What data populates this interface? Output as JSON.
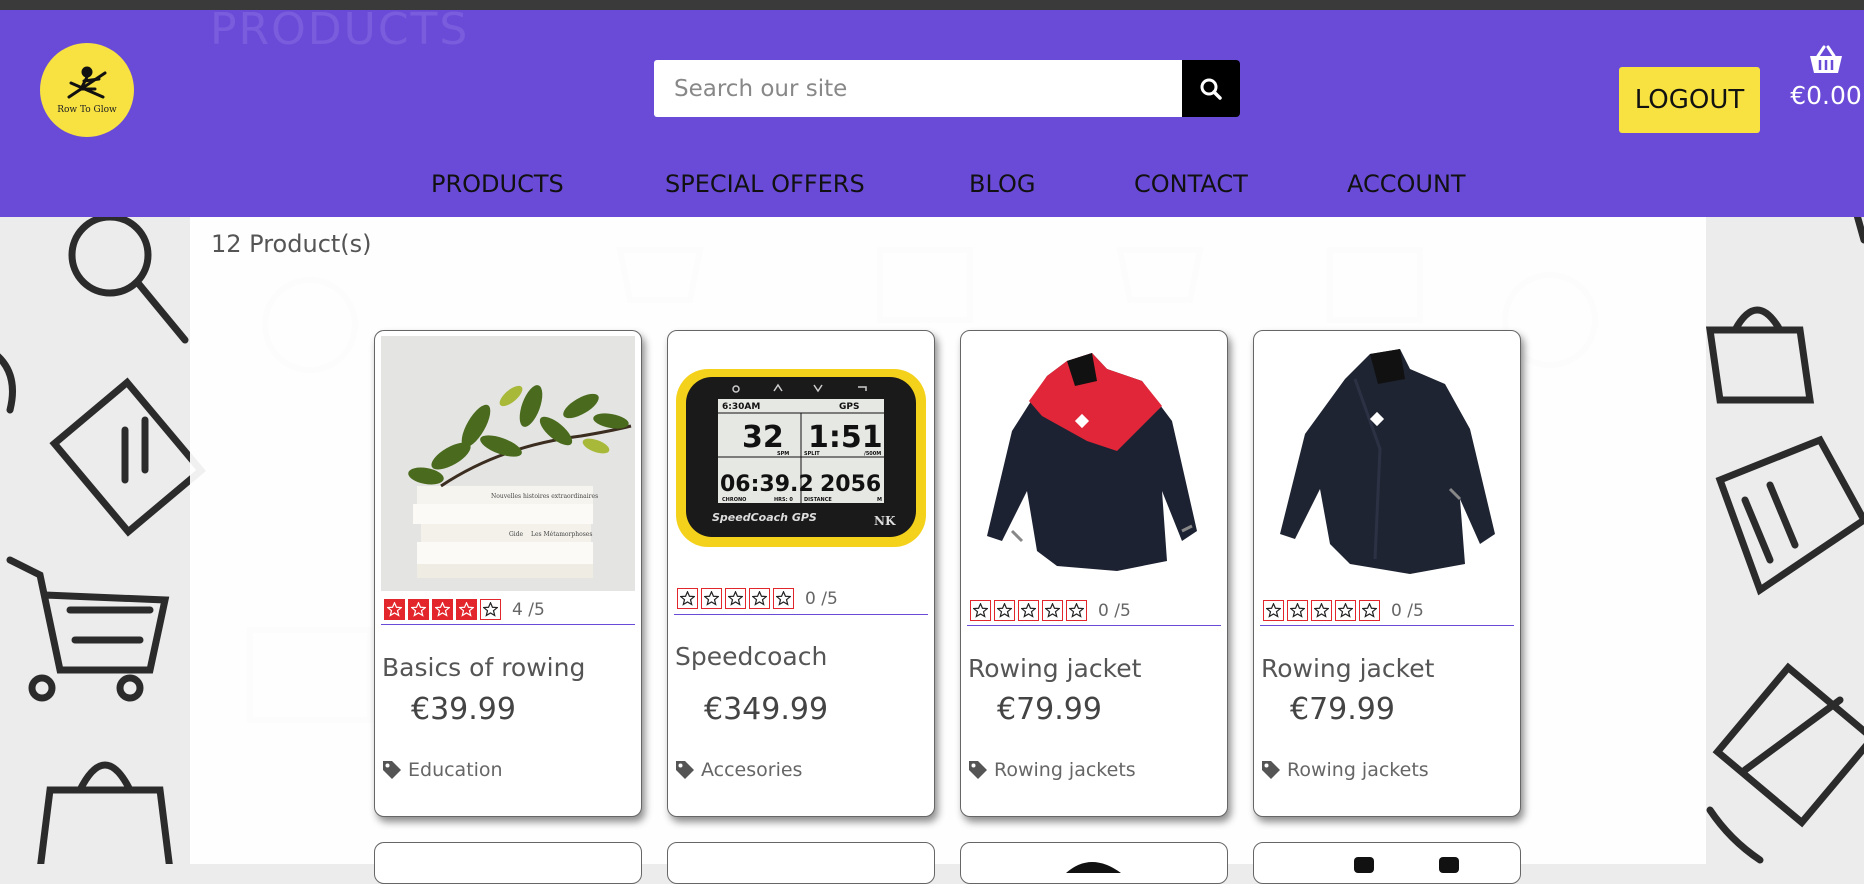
{
  "header": {
    "ghost_title": "PRODUCTS",
    "logo_text": "Row To Glow",
    "search_placeholder": "Search our site",
    "logout_label": "LOGOUT",
    "cart_total": "€0.00"
  },
  "nav": {
    "items": [
      {
        "label": "PRODUCTS"
      },
      {
        "label": "SPECIAL OFFERS"
      },
      {
        "label": "BLOG"
      },
      {
        "label": "CONTACT"
      },
      {
        "label": "ACCOUNT"
      }
    ]
  },
  "main": {
    "product_count": "12 Product(s)"
  },
  "products": [
    {
      "name": "Basics of rowing",
      "price": "€39.99",
      "rating_text": "4 /5",
      "rating": 4,
      "category": "Education",
      "image": "book-plant-icon"
    },
    {
      "name": "Speedcoach",
      "price": "€349.99",
      "rating_text": "0 /5",
      "rating": 0,
      "category": "Accesories",
      "image": "speedcoach-device-icon"
    },
    {
      "name": "Rowing jacket",
      "price": "€79.99",
      "rating_text": "0 /5",
      "rating": 0,
      "category": "Rowing jackets",
      "image": "red-jacket-icon"
    },
    {
      "name": "Rowing jacket",
      "price": "€79.99",
      "rating_text": "0 /5",
      "rating": 0,
      "category": "Rowing jackets",
      "image": "black-jacket-icon"
    }
  ],
  "speedcoach_screen": {
    "time": "6:30AM",
    "gps": "GPS",
    "stroke_rate": "32",
    "split": "1:51",
    "spm": "SPM",
    "split_label": "SPLIT",
    "per500": "/500M",
    "chrono": "06:39.2",
    "distance": "2056",
    "chrono_label": "CHRONO",
    "hrs": "HRS: 0",
    "distance_label": "DISTANCE",
    "unit": "M",
    "brand": "SpeedCoach GPS",
    "maker": "NK"
  },
  "book_titles": {
    "top": "Nouvelles histoires extraordinaires",
    "mid_left": "Gide",
    "mid_right": "Les Métamorphoses"
  },
  "colors": {
    "header_bg": "#6a4bd8",
    "accent_yellow": "#f7e241",
    "star_red": "#e3262b"
  }
}
